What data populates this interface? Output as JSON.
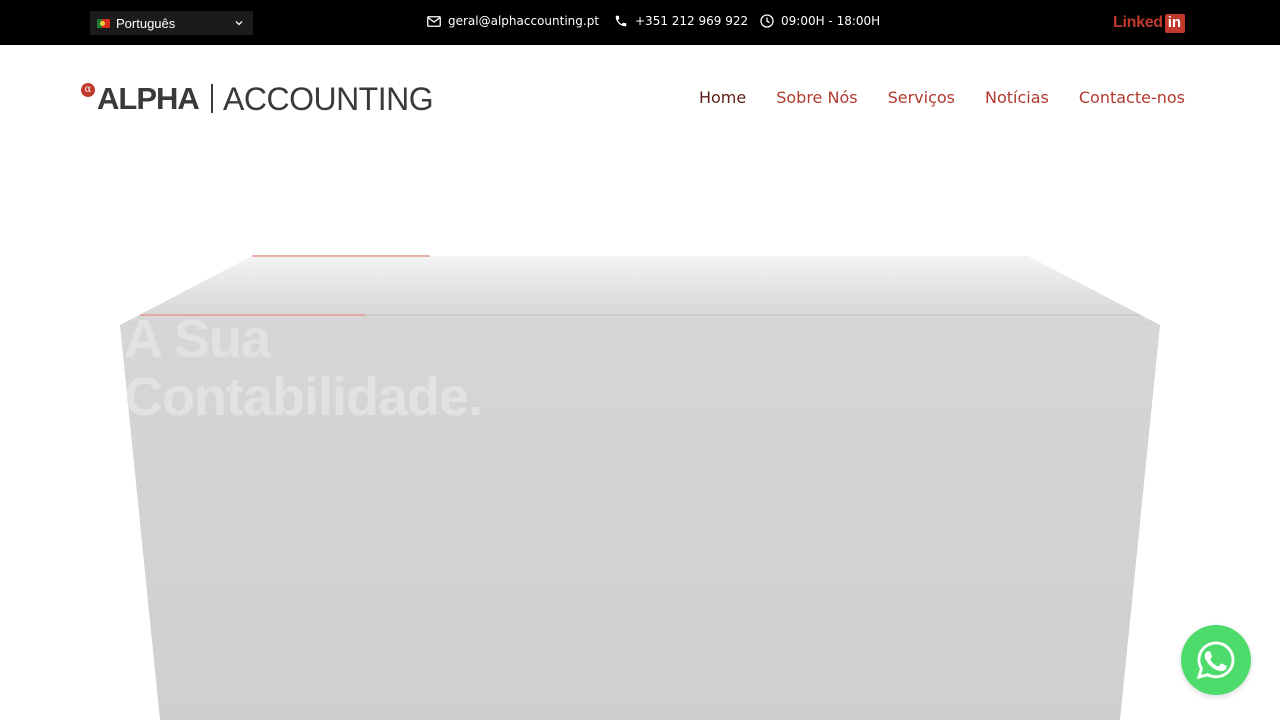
{
  "topbar": {
    "language": {
      "selected": "Português",
      "flag": "portugal-flag-icon"
    },
    "email": "geral@alphaccounting.pt",
    "phone": "+351 212 969 922",
    "hours": "09:00H - 18:00H",
    "linkedin_label": "Linked",
    "linkedin_box": "in"
  },
  "header": {
    "logo": {
      "symbol": "α",
      "word1": "ALPHA",
      "word2": "ACCOUNTING"
    },
    "nav": [
      {
        "label": "Home",
        "active": true
      },
      {
        "label": "Sobre Nós"
      },
      {
        "label": "Serviços"
      },
      {
        "label": "Notícias"
      },
      {
        "label": "Contacte-nos"
      }
    ]
  },
  "hero": {
    "heading_line1": "A Sua",
    "heading_line2": "Contabilidade."
  },
  "colors": {
    "brand_red": "#b03a2e",
    "linkedin_red": "#c0392b",
    "topbar_bg": "#000000",
    "whatsapp_green": "#4ddc6c",
    "hero_box": "#d1d1d1"
  }
}
